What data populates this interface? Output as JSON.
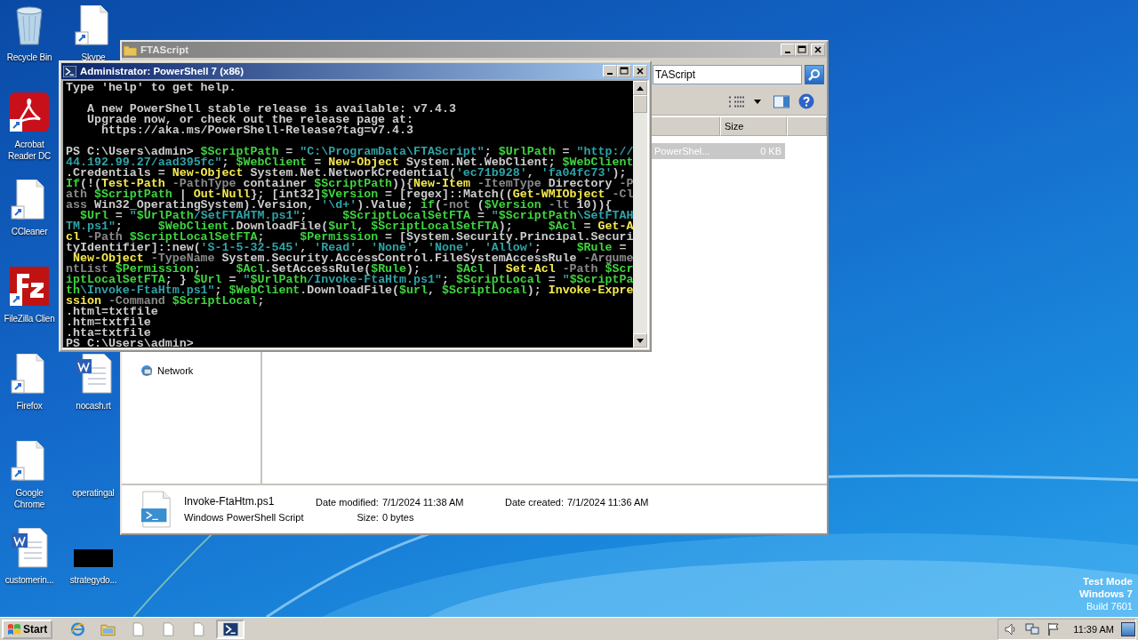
{
  "desktop": {
    "columns": [
      [
        {
          "label": "Recycle Bin",
          "kind": "recycle"
        },
        {
          "label": "Acrobat Reader DC",
          "kind": "acrobat"
        },
        {
          "label": "CCleaner",
          "kind": "shortcut"
        },
        {
          "label": "FileZilla Clien",
          "kind": "filezilla"
        },
        {
          "label": "Firefox",
          "kind": "shortcut"
        },
        {
          "label": "Google Chrome",
          "kind": "shortcut"
        },
        {
          "label": "customerin...",
          "kind": "word"
        }
      ],
      [
        {
          "label": "Skype",
          "kind": "shortcut"
        },
        {
          "label": "nocash.rt",
          "kind": "word"
        },
        {
          "label": "operatingal",
          "kind": "none"
        },
        {
          "label": "strategydo...",
          "kind": "black"
        }
      ]
    ],
    "system_info": [
      "Test Mode",
      "Windows 7",
      "Build 7601"
    ]
  },
  "explorer": {
    "title": "FTAScript",
    "address": "TAScript",
    "columns": [
      "Size"
    ],
    "rows": [
      {
        "type": "PowerShel...",
        "size": "0 KB",
        "selected": true
      }
    ],
    "nav_items": [
      {
        "label": "Network"
      }
    ],
    "details": {
      "name": "Invoke-FtaHtm.ps1",
      "type": "Windows PowerShell Script",
      "fields": [
        {
          "label": "Date modified:",
          "value": "7/1/2024 11:38 AM"
        },
        {
          "label": "Date created:",
          "value": "7/1/2024 11:36 AM"
        },
        {
          "label": "Size:",
          "value": "0 bytes"
        }
      ]
    }
  },
  "console": {
    "title": "Administrator: PowerShell 7 (x86)",
    "blocks": [
      {
        "lines": [
          [
            {
              "kind": "text",
              "text": "Type 'help' to get help."
            }
          ]
        ]
      },
      {
        "lines": [
          [
            {
              "kind": "text",
              "text": "   A new PowerShell stable release is available: v7.4.3"
            }
          ],
          [
            {
              "kind": "text",
              "text": "   Upgrade now, or check out the release page at:"
            }
          ],
          [
            {
              "kind": "text",
              "text": "     https://aka.ms/PowerShell-Release?tag=v7.4.3"
            }
          ]
        ]
      },
      {
        "lines": [
          [
            {
              "kind": "text",
              "text": "PS C:\\Users\\admin> "
            },
            {
              "kind": "var",
              "text": "$ScriptPath"
            },
            {
              "kind": "text",
              "text": " = "
            },
            {
              "kind": "str",
              "text": "\"C:\\ProgramData\\FTAScript\""
            },
            {
              "kind": "text",
              "text": "; "
            },
            {
              "kind": "var",
              "text": "$UrlPath"
            },
            {
              "kind": "text",
              "text": " = "
            },
            {
              "kind": "str",
              "text": "\"http://"
            }
          ],
          [
            {
              "kind": "str",
              "text": "44.192.99.27/aad395fc\""
            },
            {
              "kind": "text",
              "text": "; "
            },
            {
              "kind": "var",
              "text": "$WebClient"
            },
            {
              "kind": "text",
              "text": " = "
            },
            {
              "kind": "cmd",
              "text": "New-Object"
            },
            {
              "kind": "text",
              "text": " System.Net.WebClient; "
            },
            {
              "kind": "var",
              "text": "$WebClient"
            }
          ],
          [
            {
              "kind": "text",
              "text": ".Credentials = "
            },
            {
              "kind": "cmd",
              "text": "New-Object"
            },
            {
              "kind": "text",
              "text": " System.Net.NetworkCredential("
            },
            {
              "kind": "str",
              "text": "'ec71b928'"
            },
            {
              "kind": "text",
              "text": ", "
            },
            {
              "kind": "str",
              "text": "'fa04fc73'"
            },
            {
              "kind": "text",
              "text": ");"
            }
          ],
          [
            {
              "kind": "var",
              "text": "If"
            },
            {
              "kind": "text",
              "text": "(!("
            },
            {
              "kind": "cmd",
              "text": "Test-Path"
            },
            {
              "kind": "param",
              "text": " -PathType"
            },
            {
              "kind": "text",
              "text": " container "
            },
            {
              "kind": "var",
              "text": "$ScriptPath"
            },
            {
              "kind": "text",
              "text": ")){"
            },
            {
              "kind": "cmd",
              "text": "New-Item"
            },
            {
              "kind": "param",
              "text": " -ItemType"
            },
            {
              "kind": "text",
              "text": " Directory "
            },
            {
              "kind": "param",
              "text": "-P"
            }
          ],
          [
            {
              "kind": "param",
              "text": "ath "
            },
            {
              "kind": "var",
              "text": "$ScriptPath"
            },
            {
              "kind": "text",
              "text": " | "
            },
            {
              "kind": "cmd",
              "text": "Out-Null"
            },
            {
              "kind": "text",
              "text": "}; [int32]"
            },
            {
              "kind": "var",
              "text": "$Version"
            },
            {
              "kind": "text",
              "text": " = [regex]::Match(("
            },
            {
              "kind": "cmd",
              "text": "Get-WMIObject"
            },
            {
              "kind": "param",
              "text": " -Cl"
            }
          ],
          [
            {
              "kind": "param",
              "text": "ass"
            },
            {
              "kind": "text",
              "text": " Win32_OperatingSystem).Version, "
            },
            {
              "kind": "str",
              "text": "'\\d+'"
            },
            {
              "kind": "text",
              "text": ").Value; "
            },
            {
              "kind": "var",
              "text": "if"
            },
            {
              "kind": "text",
              "text": "("
            },
            {
              "kind": "param",
              "text": "-not"
            },
            {
              "kind": "text",
              "text": " ("
            },
            {
              "kind": "var",
              "text": "$Version"
            },
            {
              "kind": "param",
              "text": " -lt"
            },
            {
              "kind": "text",
              "text": " 10)){"
            }
          ],
          [
            {
              "kind": "var",
              "text": "  $Url"
            },
            {
              "kind": "text",
              "text": " = "
            },
            {
              "kind": "str",
              "text": "\""
            },
            {
              "kind": "var",
              "text": "$UrlPath"
            },
            {
              "kind": "str",
              "text": "/SetFTAHTM.ps1\""
            },
            {
              "kind": "text",
              "text": ";     "
            },
            {
              "kind": "var",
              "text": "$ScriptLocalSetFTA"
            },
            {
              "kind": "text",
              "text": " = "
            },
            {
              "kind": "str",
              "text": "\""
            },
            {
              "kind": "var",
              "text": "$ScriptPath"
            },
            {
              "kind": "str",
              "text": "\\SetFTAH"
            }
          ],
          [
            {
              "kind": "str",
              "text": "TM.ps1\""
            },
            {
              "kind": "text",
              "text": ";     "
            },
            {
              "kind": "var",
              "text": "$WebClient"
            },
            {
              "kind": "text",
              "text": ".DownloadFile("
            },
            {
              "kind": "var",
              "text": "$url"
            },
            {
              "kind": "text",
              "text": ", "
            },
            {
              "kind": "var",
              "text": "$ScriptLocalSetFTA"
            },
            {
              "kind": "text",
              "text": ");     "
            },
            {
              "kind": "var",
              "text": "$Acl"
            },
            {
              "kind": "text",
              "text": " = "
            },
            {
              "kind": "cmd",
              "text": "Get-A"
            }
          ],
          [
            {
              "kind": "cmd",
              "text": "cl"
            },
            {
              "kind": "param",
              "text": " -Path "
            },
            {
              "kind": "var",
              "text": "$ScriptLocalSetFTA"
            },
            {
              "kind": "text",
              "text": ";     "
            },
            {
              "kind": "var",
              "text": "$Permission"
            },
            {
              "kind": "text",
              "text": " = [System.Security.Principal.Securi"
            }
          ],
          [
            {
              "kind": "text",
              "text": "tyIdentifier]::new("
            },
            {
              "kind": "str",
              "text": "'S-1-5-32-545'"
            },
            {
              "kind": "text",
              "text": ", "
            },
            {
              "kind": "str",
              "text": "'Read'"
            },
            {
              "kind": "text",
              "text": ", "
            },
            {
              "kind": "str",
              "text": "'None'"
            },
            {
              "kind": "text",
              "text": ", "
            },
            {
              "kind": "str",
              "text": "'None'"
            },
            {
              "kind": "text",
              "text": ", "
            },
            {
              "kind": "str",
              "text": "'Allow'"
            },
            {
              "kind": "text",
              "text": ";     "
            },
            {
              "kind": "var",
              "text": "$Rule"
            },
            {
              "kind": "text",
              "text": " ="
            }
          ],
          [
            {
              "kind": "cmd",
              "text": " New-Object"
            },
            {
              "kind": "param",
              "text": " -TypeName"
            },
            {
              "kind": "text",
              "text": " System.Security.AccessControl.FileSystemAccessRule "
            },
            {
              "kind": "param",
              "text": "-Argume"
            }
          ],
          [
            {
              "kind": "param",
              "text": "ntList "
            },
            {
              "kind": "var",
              "text": "$Permission"
            },
            {
              "kind": "text",
              "text": ";     "
            },
            {
              "kind": "var",
              "text": "$Acl"
            },
            {
              "kind": "text",
              "text": ".SetAccessRule("
            },
            {
              "kind": "var",
              "text": "$Rule"
            },
            {
              "kind": "text",
              "text": ");     "
            },
            {
              "kind": "var",
              "text": "$Acl"
            },
            {
              "kind": "text",
              "text": " | "
            },
            {
              "kind": "cmd",
              "text": "Set-Acl"
            },
            {
              "kind": "param",
              "text": " -Path "
            },
            {
              "kind": "var",
              "text": "$Scr"
            }
          ],
          [
            {
              "kind": "var",
              "text": "iptLocalSetFTA"
            },
            {
              "kind": "text",
              "text": "; } "
            },
            {
              "kind": "var",
              "text": "$Url"
            },
            {
              "kind": "text",
              "text": " = "
            },
            {
              "kind": "str",
              "text": "\""
            },
            {
              "kind": "var",
              "text": "$UrlPath"
            },
            {
              "kind": "str",
              "text": "/Invoke-FtaHtm.ps1\""
            },
            {
              "kind": "text",
              "text": "; "
            },
            {
              "kind": "var",
              "text": "$ScriptLocal"
            },
            {
              "kind": "text",
              "text": " = "
            },
            {
              "kind": "str",
              "text": "\""
            },
            {
              "kind": "var",
              "text": "$ScriptPa"
            }
          ],
          [
            {
              "kind": "var",
              "text": "th"
            },
            {
              "kind": "str",
              "text": "\\Invoke-FtaHtm.ps1\""
            },
            {
              "kind": "text",
              "text": "; "
            },
            {
              "kind": "var",
              "text": "$WebClient"
            },
            {
              "kind": "text",
              "text": ".DownloadFile("
            },
            {
              "kind": "var",
              "text": "$url"
            },
            {
              "kind": "text",
              "text": ", "
            },
            {
              "kind": "var",
              "text": "$ScriptLocal"
            },
            {
              "kind": "text",
              "text": "); "
            },
            {
              "kind": "cmd",
              "text": "Invoke-Expre"
            }
          ],
          [
            {
              "kind": "cmd",
              "text": "ssion"
            },
            {
              "kind": "param",
              "text": " -Command "
            },
            {
              "kind": "var",
              "text": "$ScriptLocal"
            },
            {
              "kind": "text",
              "text": ";"
            }
          ],
          [
            {
              "kind": "text",
              "text": ".html=txtfile"
            }
          ],
          [
            {
              "kind": "text",
              "text": ".htm=txtfile"
            }
          ],
          [
            {
              "kind": "text",
              "text": ".hta=txtfile"
            }
          ],
          [
            {
              "kind": "text",
              "text": "PS C:\\Users\\admin>"
            }
          ]
        ]
      }
    ]
  },
  "taskbar": {
    "start": "Start",
    "buttons": [
      {
        "kind": "ie",
        "selected": false
      },
      {
        "kind": "folder",
        "selected": false
      },
      {
        "kind": "doc",
        "selected": false
      },
      {
        "kind": "doc",
        "selected": false
      },
      {
        "kind": "doc",
        "selected": false
      },
      {
        "kind": "powershell",
        "selected": true
      }
    ],
    "clock": "11:39 AM"
  }
}
